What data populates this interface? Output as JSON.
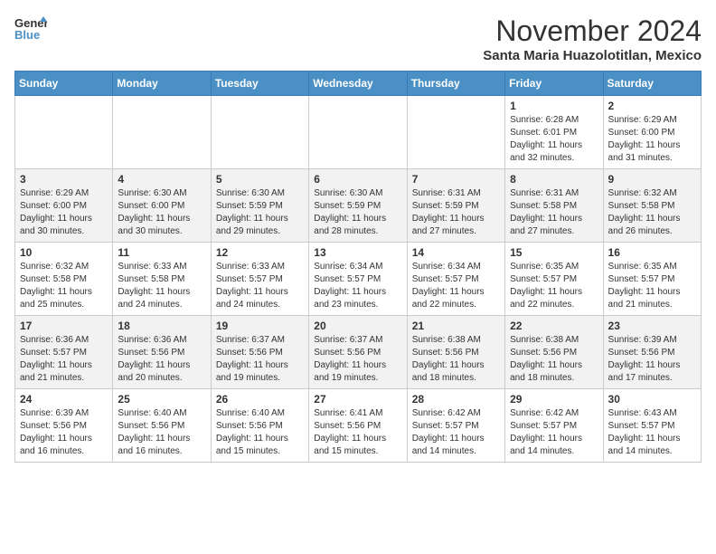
{
  "header": {
    "logo_line1": "General",
    "logo_line2": "Blue",
    "month": "November 2024",
    "location": "Santa Maria Huazolotitlan, Mexico"
  },
  "weekdays": [
    "Sunday",
    "Monday",
    "Tuesday",
    "Wednesday",
    "Thursday",
    "Friday",
    "Saturday"
  ],
  "weeks": [
    [
      {
        "day": "",
        "info": ""
      },
      {
        "day": "",
        "info": ""
      },
      {
        "day": "",
        "info": ""
      },
      {
        "day": "",
        "info": ""
      },
      {
        "day": "",
        "info": ""
      },
      {
        "day": "1",
        "info": "Sunrise: 6:28 AM\nSunset: 6:01 PM\nDaylight: 11 hours and 32 minutes."
      },
      {
        "day": "2",
        "info": "Sunrise: 6:29 AM\nSunset: 6:00 PM\nDaylight: 11 hours and 31 minutes."
      }
    ],
    [
      {
        "day": "3",
        "info": "Sunrise: 6:29 AM\nSunset: 6:00 PM\nDaylight: 11 hours and 30 minutes."
      },
      {
        "day": "4",
        "info": "Sunrise: 6:30 AM\nSunset: 6:00 PM\nDaylight: 11 hours and 30 minutes."
      },
      {
        "day": "5",
        "info": "Sunrise: 6:30 AM\nSunset: 5:59 PM\nDaylight: 11 hours and 29 minutes."
      },
      {
        "day": "6",
        "info": "Sunrise: 6:30 AM\nSunset: 5:59 PM\nDaylight: 11 hours and 28 minutes."
      },
      {
        "day": "7",
        "info": "Sunrise: 6:31 AM\nSunset: 5:59 PM\nDaylight: 11 hours and 27 minutes."
      },
      {
        "day": "8",
        "info": "Sunrise: 6:31 AM\nSunset: 5:58 PM\nDaylight: 11 hours and 27 minutes."
      },
      {
        "day": "9",
        "info": "Sunrise: 6:32 AM\nSunset: 5:58 PM\nDaylight: 11 hours and 26 minutes."
      }
    ],
    [
      {
        "day": "10",
        "info": "Sunrise: 6:32 AM\nSunset: 5:58 PM\nDaylight: 11 hours and 25 minutes."
      },
      {
        "day": "11",
        "info": "Sunrise: 6:33 AM\nSunset: 5:58 PM\nDaylight: 11 hours and 24 minutes."
      },
      {
        "day": "12",
        "info": "Sunrise: 6:33 AM\nSunset: 5:57 PM\nDaylight: 11 hours and 24 minutes."
      },
      {
        "day": "13",
        "info": "Sunrise: 6:34 AM\nSunset: 5:57 PM\nDaylight: 11 hours and 23 minutes."
      },
      {
        "day": "14",
        "info": "Sunrise: 6:34 AM\nSunset: 5:57 PM\nDaylight: 11 hours and 22 minutes."
      },
      {
        "day": "15",
        "info": "Sunrise: 6:35 AM\nSunset: 5:57 PM\nDaylight: 11 hours and 22 minutes."
      },
      {
        "day": "16",
        "info": "Sunrise: 6:35 AM\nSunset: 5:57 PM\nDaylight: 11 hours and 21 minutes."
      }
    ],
    [
      {
        "day": "17",
        "info": "Sunrise: 6:36 AM\nSunset: 5:57 PM\nDaylight: 11 hours and 21 minutes."
      },
      {
        "day": "18",
        "info": "Sunrise: 6:36 AM\nSunset: 5:56 PM\nDaylight: 11 hours and 20 minutes."
      },
      {
        "day": "19",
        "info": "Sunrise: 6:37 AM\nSunset: 5:56 PM\nDaylight: 11 hours and 19 minutes."
      },
      {
        "day": "20",
        "info": "Sunrise: 6:37 AM\nSunset: 5:56 PM\nDaylight: 11 hours and 19 minutes."
      },
      {
        "day": "21",
        "info": "Sunrise: 6:38 AM\nSunset: 5:56 PM\nDaylight: 11 hours and 18 minutes."
      },
      {
        "day": "22",
        "info": "Sunrise: 6:38 AM\nSunset: 5:56 PM\nDaylight: 11 hours and 18 minutes."
      },
      {
        "day": "23",
        "info": "Sunrise: 6:39 AM\nSunset: 5:56 PM\nDaylight: 11 hours and 17 minutes."
      }
    ],
    [
      {
        "day": "24",
        "info": "Sunrise: 6:39 AM\nSunset: 5:56 PM\nDaylight: 11 hours and 16 minutes."
      },
      {
        "day": "25",
        "info": "Sunrise: 6:40 AM\nSunset: 5:56 PM\nDaylight: 11 hours and 16 minutes."
      },
      {
        "day": "26",
        "info": "Sunrise: 6:40 AM\nSunset: 5:56 PM\nDaylight: 11 hours and 15 minutes."
      },
      {
        "day": "27",
        "info": "Sunrise: 6:41 AM\nSunset: 5:56 PM\nDaylight: 11 hours and 15 minutes."
      },
      {
        "day": "28",
        "info": "Sunrise: 6:42 AM\nSunset: 5:57 PM\nDaylight: 11 hours and 14 minutes."
      },
      {
        "day": "29",
        "info": "Sunrise: 6:42 AM\nSunset: 5:57 PM\nDaylight: 11 hours and 14 minutes."
      },
      {
        "day": "30",
        "info": "Sunrise: 6:43 AM\nSunset: 5:57 PM\nDaylight: 11 hours and 14 minutes."
      }
    ]
  ]
}
